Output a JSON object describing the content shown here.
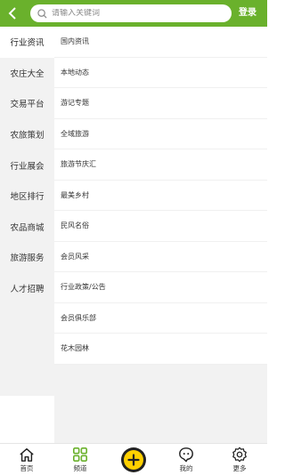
{
  "header": {
    "search_placeholder": "请输入关键词",
    "login_label": "登录",
    "accent_color": "#6ab12c"
  },
  "sidebar": {
    "items": [
      {
        "label": "行业资讯",
        "active": true
      },
      {
        "label": "农庄大全",
        "active": false
      },
      {
        "label": "交易平台",
        "active": false
      },
      {
        "label": "农旅策划",
        "active": false
      },
      {
        "label": "行业展会",
        "active": false
      },
      {
        "label": "地区排行",
        "active": false
      },
      {
        "label": "农品商城",
        "active": false
      },
      {
        "label": "旅游服务",
        "active": false
      },
      {
        "label": "人才招聘",
        "active": false
      }
    ]
  },
  "list": {
    "items": [
      {
        "label": "国内资讯"
      },
      {
        "label": "本地动态"
      },
      {
        "label": "游记专题"
      },
      {
        "label": "全域旅游"
      },
      {
        "label": "旅游节庆汇"
      },
      {
        "label": "最美乡村"
      },
      {
        "label": "民风名俗"
      },
      {
        "label": "会员风采"
      },
      {
        "label": "行业政策/公告"
      },
      {
        "label": "会员俱乐部"
      },
      {
        "label": "花木园林"
      }
    ]
  },
  "bottom_nav": {
    "items": [
      {
        "label": "首页",
        "icon": "home-icon"
      },
      {
        "label": "频道",
        "icon": "grid-icon"
      },
      {
        "label": "",
        "icon": "plus-icon"
      },
      {
        "label": "我的",
        "icon": "chat-face-icon"
      },
      {
        "label": "更多",
        "icon": "gear-icon"
      }
    ],
    "active_color": "#6ab12c",
    "center_color": "#ffd000"
  }
}
